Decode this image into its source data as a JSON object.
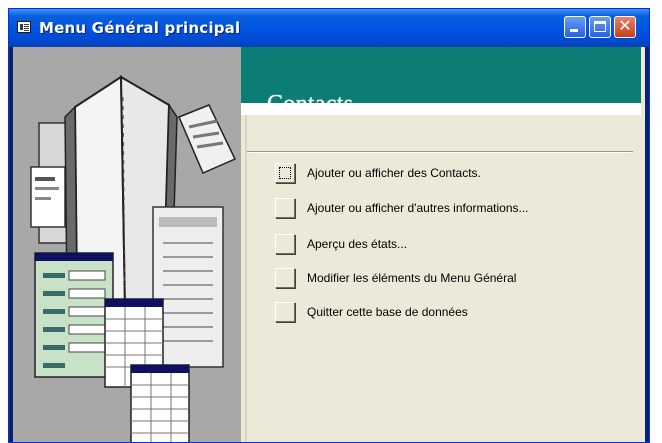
{
  "window": {
    "title": "Menu Général principal",
    "controls": {
      "close_glyph": "✕"
    }
  },
  "header": {
    "title": "Contacts",
    "band_color": "#0b7d75"
  },
  "menu": {
    "items": [
      {
        "label": "Ajouter ou afficher des Contacts.",
        "focused": true
      },
      {
        "label": "Ajouter ou afficher d'autres informations...",
        "focused": false
      },
      {
        "label": "Aperçu des états...",
        "focused": false
      },
      {
        "label": "Modifier les éléments du Menu Général",
        "focused": false
      },
      {
        "label": "Quitter cette base de données",
        "focused": false
      }
    ]
  },
  "icons": {
    "window_icon": "form-window-icon",
    "decoration": "address-book-illustration"
  },
  "colors": {
    "titlebar": "#0054e3",
    "client_bg": "#ece9d8",
    "side_panel": "#a8a8a8"
  }
}
